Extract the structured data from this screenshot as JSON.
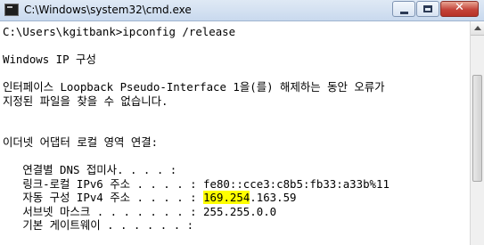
{
  "window": {
    "title": "C:\\Windows\\system32\\cmd.exe",
    "icon": "cmd-icon",
    "controls": {
      "minimize_icon": "minimize-icon",
      "maximize_icon": "maximize-icon",
      "close_icon": "close-icon",
      "close_glyph": "✕"
    }
  },
  "console": {
    "background": "#ffffff",
    "foreground": "#000000",
    "highlight_color": "#ffff00",
    "lines": [
      "C:\\Users\\kgitbank>ipconfig /release",
      "",
      "Windows IP 구성",
      "",
      "인터페이스 Loopback Pseudo-Interface 1을(를) 해제하는 동안 오류가",
      "지정된 파일을 찾을 수 없습니다.",
      "",
      "",
      "이더넷 어댑터 로컬 영역 연결:",
      "",
      "   연결별 DNS 접미사. . . . :",
      "   링크-로컬 IPv6 주소 . . . . : fe80::cce3:c8b5:fb33:a33b%11",
      "   기본 게이트웨이 . . . . . . :"
    ],
    "ipv4_line": {
      "label": "   자동 구성 IPv4 주소 . . . . : ",
      "highlighted": "169.254",
      "rest": ".163.59"
    },
    "subnet_line": "   서브넷 마스크 . . . . . . . : 255.255.0.0"
  }
}
